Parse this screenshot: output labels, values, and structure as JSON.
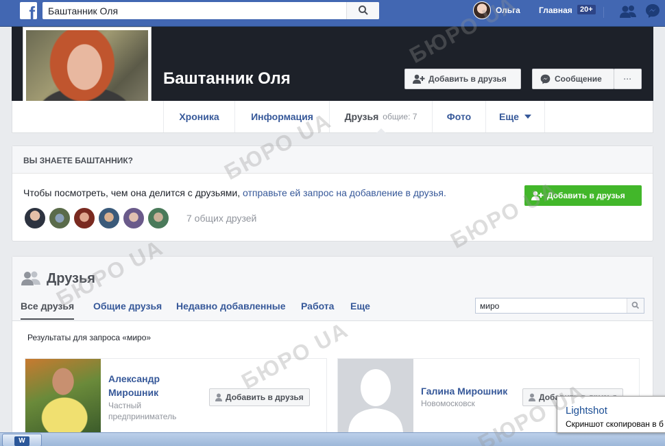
{
  "topbar": {
    "search_value": "Баштанник Оля",
    "user_name": "Ольга",
    "home_label": "Главная",
    "home_badge": "20+",
    "icons": [
      "facebook-logo-icon",
      "search-icon",
      "friend-requests-icon",
      "messenger-icon"
    ]
  },
  "profile": {
    "name": "Баштанник Оля",
    "add_friend_label": "Добавить в друзья",
    "message_label": "Сообщение",
    "more_label": "···"
  },
  "tabs": {
    "timeline": "Хроника",
    "about": "Информация",
    "friends": "Друзья",
    "friends_count": "общие: 7",
    "photos": "Фото",
    "more": "Еще"
  },
  "know": {
    "heading": "ВЫ ЗНАЕТЕ БАШТАННИК?",
    "text_plain": "Чтобы посмотреть, чем она делится с друзьями, ",
    "text_link": "отправьте ей запрос на добавление в друзья.",
    "add_label": "Добавить в друзья",
    "mutual_count": "7 общих друзей"
  },
  "friends": {
    "title": "Друзья",
    "subtabs": [
      "Все друзья",
      "Общие друзья",
      "Недавно добавленные",
      "Работа",
      "Еще"
    ],
    "search_value": "миро",
    "results_label": "Результаты для запроса «миро»",
    "cards": [
      {
        "name_line1": "Александр",
        "name_line2": "Мирошник",
        "sub1": "Частный",
        "sub2": "предприниматель",
        "button": "Добавить в друзья"
      },
      {
        "name_line1": "Галина Мирошник",
        "sub1": "Новомосковск",
        "button": "Добавить в друзья"
      }
    ]
  },
  "taskbar": {
    "word_label": "W"
  },
  "toast": {
    "title": "Lightshot",
    "message": "Скриншот скопирован в б"
  },
  "watermark": "БЮРО UA",
  "colors": {
    "fb_blue": "#4267b2",
    "link": "#365899",
    "green": "#42b72a"
  }
}
